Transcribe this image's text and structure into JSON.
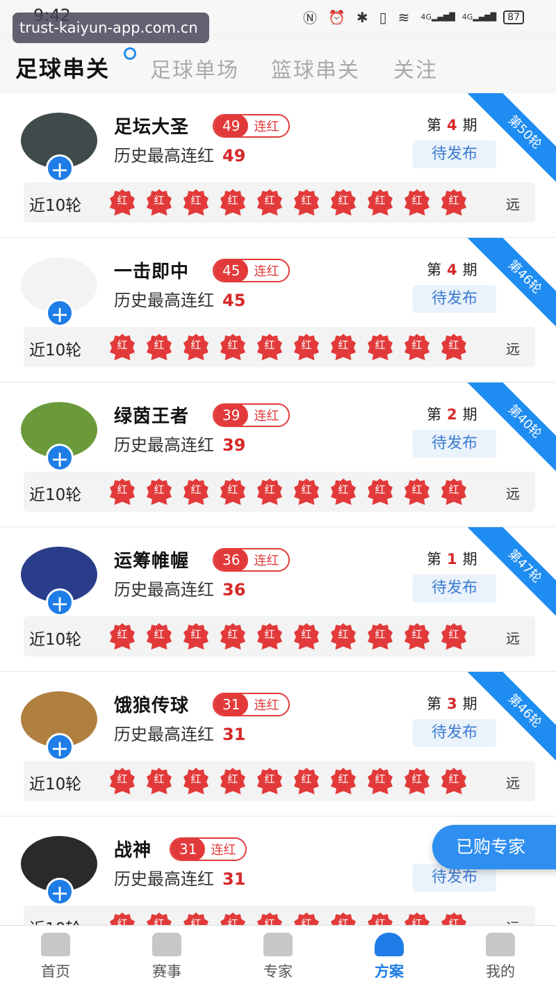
{
  "status_bar": {
    "time": "9:42",
    "battery": "87",
    "network_1": "4G",
    "network_2": "4G"
  },
  "watermark": "trust-kaiyun-app.com.cn",
  "tabs": [
    {
      "label": "足球串关"
    },
    {
      "label": "足球单场"
    },
    {
      "label": "篮球串关"
    },
    {
      "label": "关注"
    }
  ],
  "common": {
    "streak_label": "连红",
    "history_label": "历史最高连红",
    "period_prefix": "第",
    "period_suffix": "期",
    "publish_label": "待发布",
    "rounds_label": "近10轮",
    "badge_text": "红",
    "far_label": "远"
  },
  "experts": [
    {
      "name": "足坛大圣",
      "streak": "49",
      "history": "49",
      "period": "4",
      "ribbon": "第50轮",
      "avatar_color": "#3f4a4a"
    },
    {
      "name": "一击即中",
      "streak": "45",
      "history": "45",
      "period": "4",
      "ribbon": "第46轮",
      "avatar_color": "#f3f3f3"
    },
    {
      "name": "绿茵王者",
      "streak": "39",
      "history": "39",
      "period": "2",
      "ribbon": "第40轮",
      "avatar_color": "#6a9a3a"
    },
    {
      "name": "运筹帷幄",
      "streak": "36",
      "history": "36",
      "period": "1",
      "ribbon": "第47轮",
      "avatar_color": "#2a3d8a"
    },
    {
      "name": "饿狼传球",
      "streak": "31",
      "history": "31",
      "period": "3",
      "ribbon": "第46轮",
      "avatar_color": "#b08040"
    },
    {
      "name": "战神",
      "streak": "31",
      "history": "31",
      "period": "",
      "ribbon": "",
      "avatar_color": "#2a2a2a"
    }
  ],
  "float_button": "已购专家",
  "bottom_nav": [
    {
      "label": "首页"
    },
    {
      "label": "赛事"
    },
    {
      "label": "专家"
    },
    {
      "label": "方案"
    },
    {
      "label": "我的"
    }
  ],
  "colors": {
    "accent": "#1e7de6",
    "red": "#e23a3a"
  }
}
